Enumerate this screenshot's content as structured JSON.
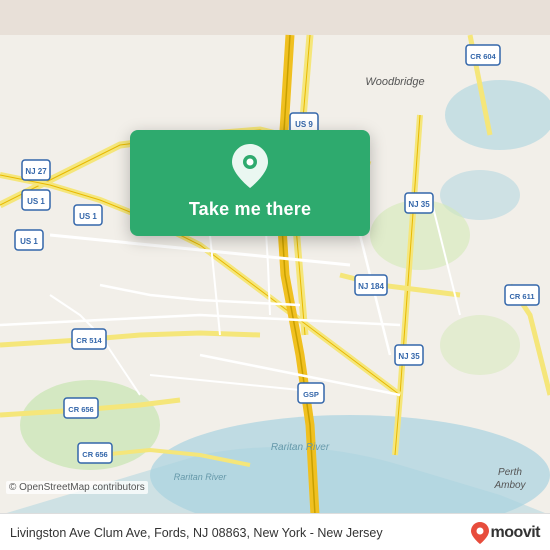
{
  "map": {
    "alt": "Map of Fords, NJ area showing roads and highways"
  },
  "overlay": {
    "take_me_there_label": "Take me there"
  },
  "bottom_bar": {
    "address": "Livingston Ave Clum Ave, Fords, NJ 08863, New York - New Jersey",
    "moovit_label": "moovit"
  },
  "credits": {
    "osm": "© OpenStreetMap contributors"
  },
  "colors": {
    "green": "#2eaa6e",
    "road_yellow": "#f5e67a",
    "road_white": "#ffffff",
    "water": "#aad3df",
    "land": "#f2efe9",
    "park": "#d0e8b0"
  }
}
